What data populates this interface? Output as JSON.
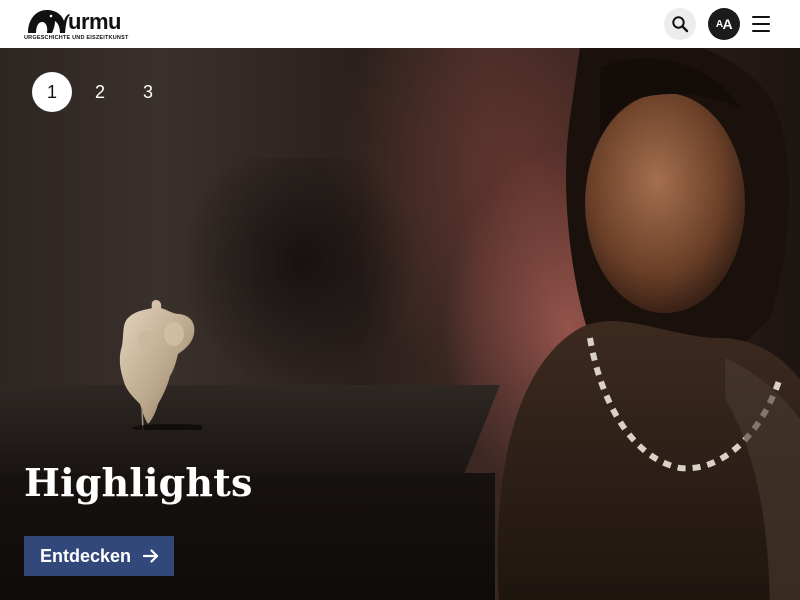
{
  "header": {
    "logo_word": "urmu",
    "logo_subtitle": "URGESCHICHTE UND EISZEITKUNST",
    "icons": {
      "search": "search-icon",
      "font_size": "font-size-icon",
      "menu": "hamburger-menu-icon"
    },
    "font_size_label_small": "A",
    "font_size_label_large": "A"
  },
  "hero": {
    "pages": [
      "1",
      "2",
      "3"
    ],
    "active_page": "1",
    "title": "Highlights",
    "cta_label": "Entdecken",
    "cta_icon": "arrow-right-icon"
  },
  "colors": {
    "cta_background": "#32477a",
    "header_background": "#ffffff",
    "active_page_background": "#ffffff"
  }
}
